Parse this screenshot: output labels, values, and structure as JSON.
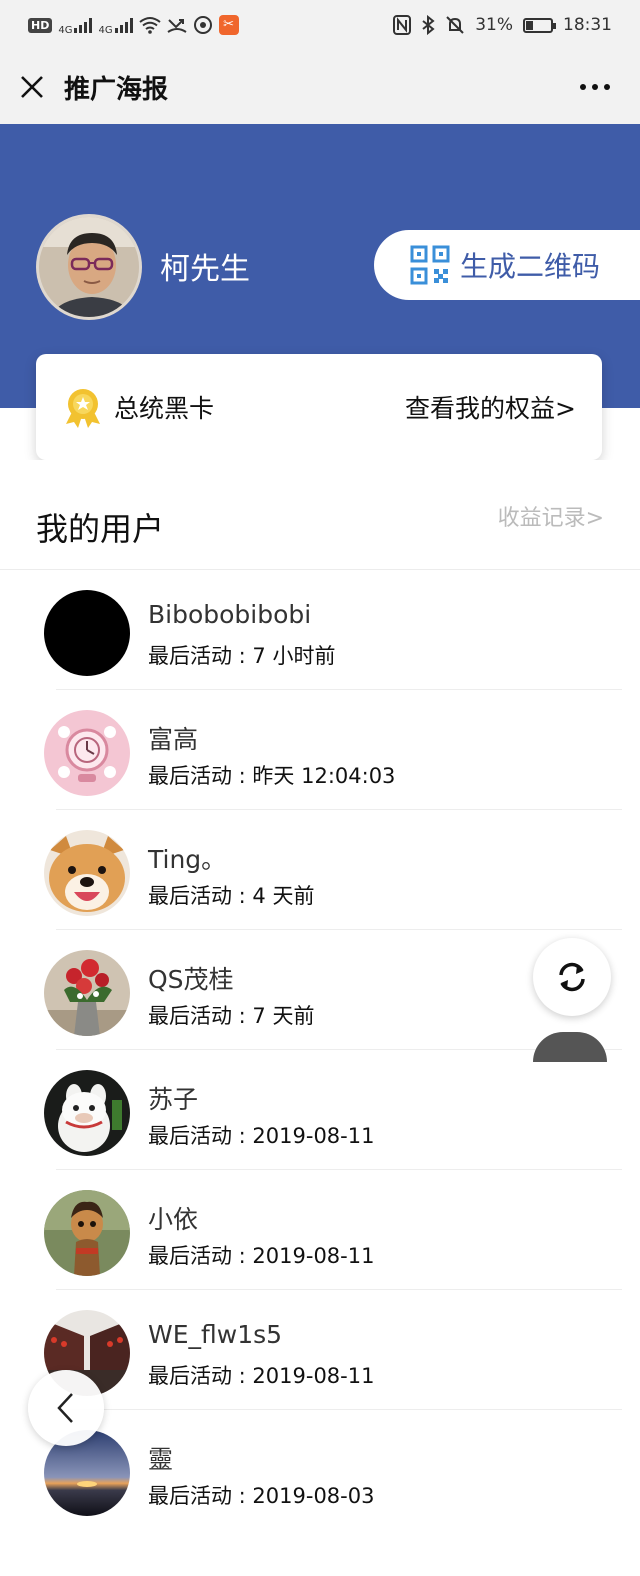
{
  "status_bar": {
    "network_badge": "HD",
    "signal_1_label": "4G",
    "signal_2_label": "4G",
    "battery_percent": "31%",
    "battery_level": 0.31,
    "time": "18:31"
  },
  "title_bar": {
    "title": "推广海报"
  },
  "profile": {
    "name": "柯先生",
    "qr_button_label": "生成二维码"
  },
  "membership_card": {
    "title": "总统黑卡",
    "link": "查看我的权益>"
  },
  "users_section": {
    "title": "我的用户",
    "link": "收益记录>",
    "meta_prefix": "最后活动 : ",
    "items": [
      {
        "name": "Bibobobibobi",
        "last_active": "最后活动 : 7 小时前"
      },
      {
        "name": "富高",
        "last_active": "最后活动 : 昨天 12:04:03"
      },
      {
        "name": "Ting。",
        "last_active": "最后活动 : 4 天前"
      },
      {
        "name": "QS茂桂",
        "last_active": "最后活动 : 7 天前"
      },
      {
        "name": "苏子",
        "last_active": "最后活动 : 2019-08-11"
      },
      {
        "name": "小依",
        "last_active": "最后活动 : 2019-08-11"
      },
      {
        "name": "WE_flw1s5",
        "last_active": "最后活动 : 2019-08-11"
      },
      {
        "name": "靈",
        "last_active": "最后活动 : 2019-08-03"
      }
    ]
  },
  "icons": {
    "close": "close-icon",
    "more": "more-icon",
    "qr": "qr-code-icon",
    "medal": "medal-icon",
    "refresh": "refresh-icon",
    "back": "chevron-left-icon"
  },
  "colors": {
    "brand_blue": "#3f5ca8",
    "medal_gold": "#f2c230"
  }
}
